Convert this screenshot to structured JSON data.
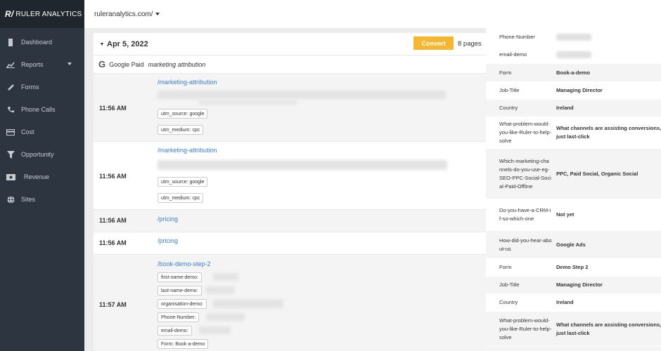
{
  "app": {
    "logo_mark": "R/",
    "logo_text": "RULER ANALYTICS"
  },
  "sidebar": {
    "items": [
      {
        "label": "Dashboard",
        "icon": "dashboard-icon"
      },
      {
        "label": "Reports",
        "icon": "chart-icon",
        "has_caret": true
      },
      {
        "label": "Forms",
        "icon": "pencil-icon"
      },
      {
        "label": "Phone Calls",
        "icon": "phone-icon"
      },
      {
        "label": "Cost",
        "icon": "card-icon"
      },
      {
        "label": "Opportunity",
        "icon": "funnel-icon"
      },
      {
        "label": "Revenue",
        "icon": "money-icon"
      },
      {
        "label": "Sites",
        "icon": "globe-icon"
      }
    ]
  },
  "topbar": {
    "site": "ruleranalytics.com/"
  },
  "session": {
    "date": "Apr 5, 2022",
    "convert_label": "Convert",
    "pages_label": "8 pages",
    "source_name": "Google Paid",
    "campaign": "marketing attribution"
  },
  "visits": [
    {
      "time": "11:56 AM",
      "path": "/marketing-attribution",
      "tags": [
        "utm_source: google",
        "utm_medium: cpc"
      ]
    },
    {
      "time": "11:56 AM",
      "path": "/marketing-attribution",
      "tags": [
        "utm_source: google",
        "utm_medium: cpc"
      ]
    },
    {
      "time": "11:56 AM",
      "path": "/pricing",
      "tags": []
    },
    {
      "time": "11:56 AM",
      "path": "/pricing",
      "tags": []
    },
    {
      "time": "11:57 AM",
      "path": "/book-demo-step-2",
      "tags": [
        "first-name-demo:",
        "last-name-demo:",
        "organisation-demo:",
        "Phone-Number:",
        "email-demo:",
        "Form: Book-a-demo"
      ]
    }
  ],
  "details": [
    {
      "key": "Phone-Number",
      "value": ""
    },
    {
      "key": "email-demo",
      "value": ""
    },
    {
      "key": "Form",
      "value": "Book-a-demo"
    },
    {
      "key": "Job-Title",
      "value": "Managing Director"
    },
    {
      "key": "Country",
      "value": "Ireland"
    },
    {
      "key": "What-problem-would-you-like-Ruler-to-help-solve",
      "value": "What channels are assisting conversions, just last-click"
    },
    {
      "key": "Which-marketing-channels-do-you-use-eg-SEO-PPC-Social-Social-Paid-Offline",
      "value": "PPC, Paid Social, Organic Social"
    },
    {
      "key": "Do-you-have-a-CRM-if-so-which-one",
      "value": "Not yet"
    },
    {
      "key": "How-did-you-hear-about-us",
      "value": "Google Ads"
    },
    {
      "key": "Form",
      "value": "Demo Step 2"
    },
    {
      "key": "Job-Title",
      "value": "Managing Director"
    },
    {
      "key": "Country",
      "value": "Ireland"
    },
    {
      "key": "What-problem-would-you-like-Ruler-to-help-solve",
      "value": "What channels are assisting conversions, just last-click"
    }
  ],
  "colors": {
    "sidebar": "#2d3540",
    "accent_button": "#f5b731",
    "link": "#3d7cc9"
  }
}
